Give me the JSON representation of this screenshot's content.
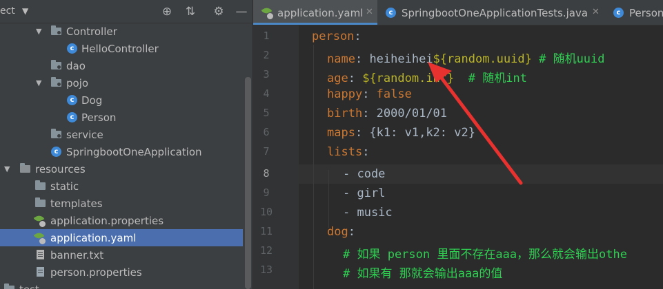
{
  "project_panel": {
    "title": "ect",
    "tree": [
      {
        "label": "Controller",
        "icon": "package-folder-icon",
        "expanded": true
      },
      {
        "label": "HelloController",
        "icon": "java-class-icon"
      },
      {
        "label": "dao",
        "icon": "package-folder-icon"
      },
      {
        "label": "pojo",
        "icon": "package-folder-icon",
        "expanded": true
      },
      {
        "label": "Dog",
        "icon": "java-class-icon"
      },
      {
        "label": "Person",
        "icon": "java-class-icon"
      },
      {
        "label": "service",
        "icon": "package-folder-icon"
      },
      {
        "label": "SpringbootOneApplication",
        "icon": "spring-boot-class-icon"
      },
      {
        "label": "resources",
        "icon": "resources-folder-icon",
        "expanded": true
      },
      {
        "label": "static",
        "icon": "folder-icon"
      },
      {
        "label": "templates",
        "icon": "folder-icon"
      },
      {
        "label": "application.properties",
        "icon": "spring-config-icon"
      },
      {
        "label": "application.yaml",
        "icon": "spring-config-icon",
        "selected": true
      },
      {
        "label": "banner.txt",
        "icon": "text-file-icon"
      },
      {
        "label": "person.properties",
        "icon": "properties-file-icon"
      },
      {
        "label": "test",
        "icon": "folder-icon"
      }
    ]
  },
  "tabs": [
    {
      "label": "application.yaml",
      "active": true
    },
    {
      "label": "SpringbootOneApplicationTests.java"
    },
    {
      "label": "Person"
    }
  ],
  "editor": {
    "current_line": 8,
    "line_numbers": [
      "1",
      "2",
      "3",
      "4",
      "5",
      "6",
      "7",
      "8",
      "9",
      "10",
      "11",
      "12",
      "13"
    ],
    "lines": [
      {
        "key": "person",
        "sep": ":",
        "value": "",
        "comment": ""
      },
      {
        "key": "name",
        "sep": ": ",
        "value": "heiheihei",
        "placeholder": "${random.uuid}",
        "comment": " # 随机uuid"
      },
      {
        "key": "age",
        "sep": ": ",
        "value": "",
        "placeholder": "${random.int}",
        "comment": "  # 随机int"
      },
      {
        "key": "happy",
        "sep": ": ",
        "value": "false",
        "comment": ""
      },
      {
        "key": "birth",
        "sep": ": ",
        "value": "2000/01/01",
        "comment": ""
      },
      {
        "key": "maps",
        "sep": ": ",
        "value": "{k1: v1,k2: v2}",
        "comment": ""
      },
      {
        "key": "lists",
        "sep": ":",
        "value": "",
        "comment": ""
      },
      {
        "item": "- code"
      },
      {
        "item": "- girl"
      },
      {
        "item": "- music"
      },
      {
        "key": "dog",
        "sep": ":",
        "value": "",
        "comment": ""
      },
      {
        "comment_only": "# 如果 person 里面不存在aaa，那么就会输出othe"
      },
      {
        "comment_only": "# 如果有 那就会输出aaa的值"
      }
    ]
  },
  "annotation": {
    "color": "#e8322f"
  }
}
